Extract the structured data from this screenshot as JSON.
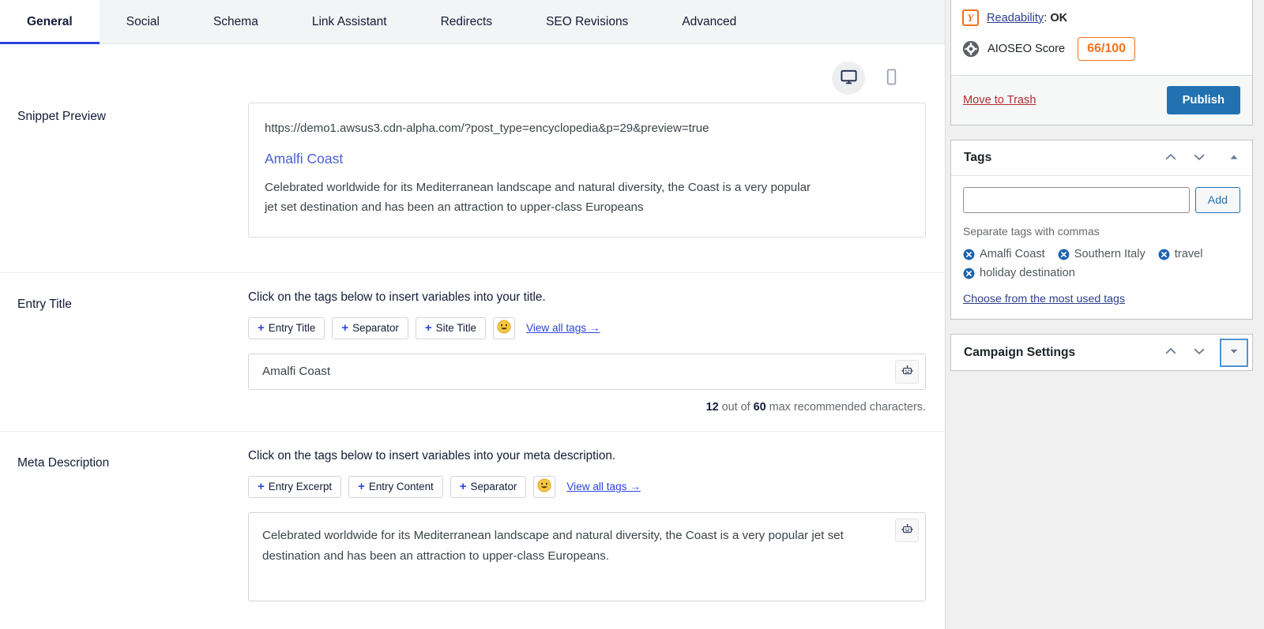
{
  "tabs": [
    {
      "label": "General",
      "active": true
    },
    {
      "label": "Social",
      "active": false
    },
    {
      "label": "Schema",
      "active": false
    },
    {
      "label": "Link Assistant",
      "active": false
    },
    {
      "label": "Redirects",
      "active": false
    },
    {
      "label": "SEO Revisions",
      "active": false
    },
    {
      "label": "Advanced",
      "active": false
    }
  ],
  "device_toggle": {
    "desktop_icon": "desktop-monitor-icon",
    "mobile_icon": "mobile-phone-icon",
    "active": "desktop"
  },
  "snippet": {
    "label": "Snippet Preview",
    "url": "https://demo1.awsus3.cdn-alpha.com/?post_type=encyclopedia&p=29&preview=true",
    "title": "Amalfi Coast",
    "description": "Celebrated worldwide for its Mediterranean landscape and natural diversity, the Coast is a very popular jet set destination and has been an attraction to upper-class Europeans"
  },
  "entry_title": {
    "label": "Entry Title",
    "instruction": "Click on the tags below to insert variables into your title.",
    "chips": [
      "Entry Title",
      "Separator",
      "Site Title"
    ],
    "emoji_icon": "smiley-face-icon",
    "view_all_link": "View all tags →",
    "value": "Amalfi Coast",
    "ai_icon": "robot-ai-icon",
    "counter_count": "12",
    "counter_mid": " out of ",
    "counter_max": "60",
    "counter_suffix": " max recommended characters."
  },
  "meta_description": {
    "label": "Meta Description",
    "instruction": "Click on the tags below to insert variables into your meta description.",
    "chips": [
      "Entry Excerpt",
      "Entry Content",
      "Separator"
    ],
    "emoji_icon": "smiley-face-icon",
    "view_all_link": "View all tags →",
    "value": "Celebrated worldwide for its Mediterranean landscape and natural diversity, the Coast is a very popular jet set destination and has been an attraction to upper-class Europeans.",
    "ai_icon": "robot-ai-icon"
  },
  "sidebar": {
    "scores": {
      "readability_icon": "yoast-logo-icon",
      "readability_label": "Readability",
      "readability_sep": ": ",
      "readability_value": "OK",
      "aioseo_icon": "aioseo-gear-icon",
      "aioseo_label": "AIOSEO Score",
      "aioseo_value": "66/100",
      "aioseo_color": "#f2711c"
    },
    "actions": {
      "trash_label": "Move to Trash",
      "trash_color": "#b32d2e",
      "publish_label": "Publish",
      "publish_color": "#2271b1"
    },
    "tags_panel": {
      "title": "Tags",
      "move_up_icon": "chevron-up-icon",
      "move_down_icon": "chevron-down-icon",
      "collapse_icon": "triangle-up-icon",
      "input_value": "",
      "input_placeholder": "",
      "add_label": "Add",
      "hint": "Separate tags with commas",
      "tags": [
        "Amalfi Coast",
        "Southern Italy",
        "travel",
        "holiday destination"
      ],
      "remove_icon": "circle-x-icon",
      "most_used_link": "Choose from the most used tags"
    },
    "campaign_panel": {
      "title": "Campaign Settings",
      "move_up_icon": "chevron-up-icon",
      "move_down_icon": "chevron-down-icon",
      "expand_icon": "triangle-down-icon"
    }
  }
}
